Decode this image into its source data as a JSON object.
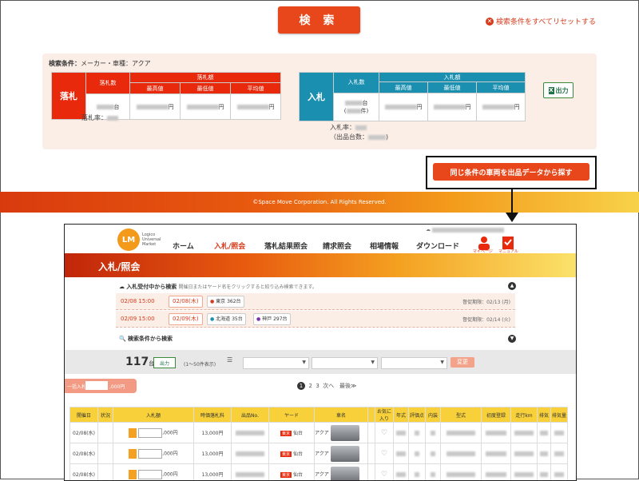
{
  "search": {
    "button_label": "検 索",
    "reset_label": "検索条件をすべてリセットする"
  },
  "summary": {
    "condition_label": "検索条件：",
    "condition_value": "メーカー・車種：アクア",
    "winning": {
      "side_label": "落札",
      "count_header": "落札数",
      "price_header": "落札額",
      "max_header": "最高値",
      "min_header": "最低値",
      "avg_header": "平均値",
      "count_unit": "台",
      "yen_unit": "円",
      "rate_label": "落札率："
    },
    "bidding": {
      "side_label": "入札",
      "count_header": "入札数",
      "price_header": "入札額",
      "max_header": "最高値",
      "min_header": "最低値",
      "avg_header": "平均値",
      "count_unit": "台",
      "item_unit": "件",
      "yen_unit": "円",
      "rate_label": "入札率：",
      "listing_label": "（出品台数："
    },
    "excel_label": "出力"
  },
  "callout_button": "同じ条件の車両を出品データから探す",
  "footer_copyright": "©Space Move Corporation. All Rights Reserved.",
  "inner": {
    "logo_text": "LM",
    "logo_caption": [
      "Logico",
      "Universal",
      "Market"
    ],
    "nav": [
      "ホーム",
      "入札/照会",
      "落札結果照会",
      "請求照会",
      "相場情報",
      "ダウンロード"
    ],
    "mypage_label": "マイページ",
    "manual_label": "マニュアル",
    "page_title": "入札/照会",
    "accepting_header": "入札受付中から検索",
    "accepting_sub": "開催日またはヤード名をクリックすると絞り込み検索できます。",
    "rows": [
      {
        "time": "02/08 15:00",
        "date": "02/08(木)",
        "loc1": "東京",
        "loc1_count": "362台",
        "loc2": "",
        "loc2_count": "",
        "deadline": "督促期限：02/13 (月)"
      },
      {
        "time": "02/09 15:00",
        "date": "02/09(木)",
        "loc1": "北海道",
        "loc1_count": "35台",
        "loc2": "神戸",
        "loc2_count": "297台",
        "deadline": "督促期限：02/14 (火)"
      }
    ],
    "condition_search": "検索条件から検索",
    "result_count": "117",
    "result_unit": "台",
    "excel_label": "出力",
    "range_text": "(1〜50件表示)",
    "sort_label": "表示順",
    "change_button": "変更",
    "pager": [
      "1",
      "2",
      "3",
      "次へ",
      "最後≫"
    ],
    "bulk_label": "一括入札",
    "bulk_unit": ",000円",
    "table_headers": [
      "開催日",
      "状況",
      "入札額",
      "時価落札料",
      "出品No.",
      "ヤード",
      "車名",
      "",
      "お気に入り",
      "年式",
      "評価点",
      "内装",
      "型式",
      "初度登録",
      "走行km",
      "排気",
      "排気量"
    ],
    "table_rows": [
      {
        "date": "02/08(水)",
        "price": "13,000円",
        "yard": "東京",
        "city": "仙台",
        "car": "アクア",
        "unit": ",000円"
      },
      {
        "date": "02/08(水)",
        "price": "13,000円",
        "yard": "東京",
        "city": "仙台",
        "car": "アクア",
        "unit": ",000円"
      },
      {
        "date": "02/08(水)",
        "price": "13,000円",
        "yard": "東京",
        "city": "仙台",
        "car": "アクア",
        "unit": ",000円"
      }
    ]
  }
}
